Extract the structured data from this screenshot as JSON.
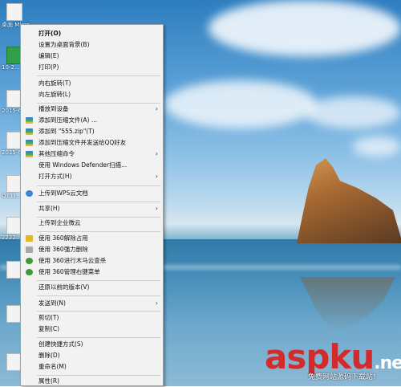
{
  "menu": {
    "items": [
      {
        "label": "打开(O)",
        "bold": true
      },
      {
        "label": "设置为桌面背景(B)"
      },
      {
        "label": "编辑(E)"
      },
      {
        "label": "打印(P)"
      },
      {
        "label": "向右旋转(T)"
      },
      {
        "label": "向左旋转(L)"
      },
      {
        "label": "播放到设备",
        "submenu": true
      },
      {
        "label": "添加到压缩文件(A) ...",
        "icon": "zip-icon"
      },
      {
        "label": "添加到 \"555.zip\"(T)",
        "icon": "zip-icon"
      },
      {
        "label": "添加到压缩文件并发送给QQ好友",
        "icon": "zip-icon"
      },
      {
        "label": "其他压缩命令",
        "icon": "zip-icon",
        "submenu": true
      },
      {
        "label": "使用 Windows Defender扫描..."
      },
      {
        "label": "打开方式(H)",
        "submenu": true
      },
      {
        "label": "上传到WPS云文档",
        "icon": "wps-cloud-icon"
      },
      {
        "label": "共享(H)",
        "submenu": true
      },
      {
        "label": "上传到企业微云"
      },
      {
        "label": "使用 360解除占用",
        "icon": "360-unlock-icon"
      },
      {
        "label": "使用 360强力删除",
        "icon": "360-delete-icon"
      },
      {
        "label": "使用 360进行木马云查杀",
        "icon": "360-scan-icon"
      },
      {
        "label": "使用 360管理右键菜单",
        "icon": "360-menu-icon"
      },
      {
        "label": "还原以前的版本(V)"
      },
      {
        "label": "发送到(N)",
        "submenu": true
      },
      {
        "label": "剪切(T)"
      },
      {
        "label": "复制(C)"
      },
      {
        "label": "创建快捷方式(S)"
      },
      {
        "label": "删除(D)"
      },
      {
        "label": "重命名(M)"
      },
      {
        "label": "属性(R)"
      }
    ]
  },
  "watermark": {
    "brand": "aspku",
    "tld": ".net",
    "tagline": "免费网站源码下载站!"
  },
  "desktop": {
    "labels": [
      "桌面 Micro...",
      "10-2...",
      "2015-6...",
      "2015-6...",
      "Q111...",
      "2222..."
    ]
  }
}
